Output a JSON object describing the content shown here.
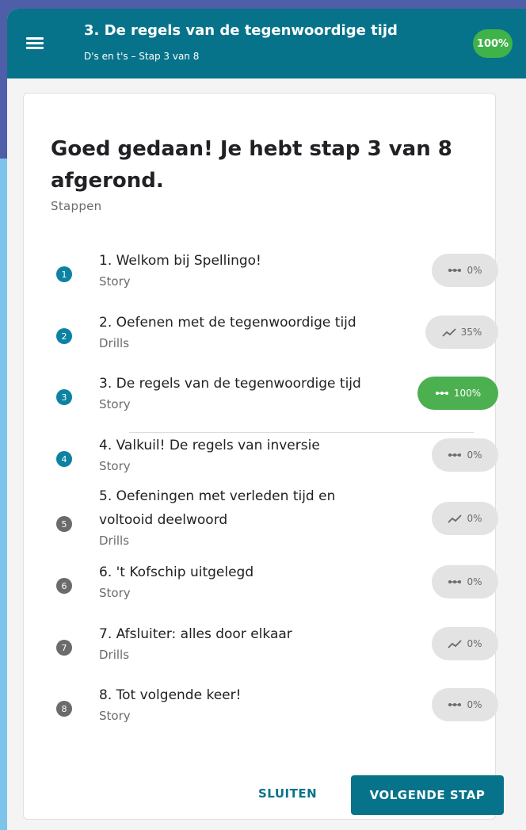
{
  "header": {
    "title": "3. De regels van de tegenwoordige tijd",
    "subtitle": "D's en t's – Stap 3 van 8",
    "progress": "100%"
  },
  "card": {
    "heading": "Goed gedaan! Je hebt stap 3 van 8 afgerond.",
    "steps_label": "Stappen"
  },
  "steps": [
    {
      "num": "1",
      "title": "1. Welkom bij Spellingo!",
      "kind": "Story",
      "progress": "0%",
      "icon": "dots-icon",
      "status": "done"
    },
    {
      "num": "2",
      "title": "2. Oefenen met de tegenwoordige tijd",
      "kind": "Drills",
      "progress": "35%",
      "icon": "trend-icon",
      "status": "done"
    },
    {
      "num": "3",
      "title": "3. De regels van de tegenwoordige tijd",
      "kind": "Story",
      "progress": "100%",
      "icon": "dots-icon",
      "status": "done"
    },
    {
      "num": "4",
      "title": "4. Valkuil! De regels van inversie",
      "kind": "Story",
      "progress": "0%",
      "icon": "dots-icon",
      "status": "next"
    },
    {
      "num": "5",
      "title": "5. Oefeningen met verleden tijd en voltooid deelwoord",
      "kind": "Drills",
      "progress": "0%",
      "icon": "trend-icon",
      "status": "locked"
    },
    {
      "num": "6",
      "title": "6. 't Kofschip uitgelegd",
      "kind": "Story",
      "progress": "0%",
      "icon": "dots-icon",
      "status": "locked"
    },
    {
      "num": "7",
      "title": "7. Afsluiter: alles door elkaar",
      "kind": "Drills",
      "progress": "0%",
      "icon": "trend-icon",
      "status": "locked"
    },
    {
      "num": "8",
      "title": "8. Tot volgende keer!",
      "kind": "Story",
      "progress": "0%",
      "icon": "dots-icon",
      "status": "locked"
    }
  ],
  "actions": {
    "close": "SLUITEN",
    "next": "VOLGENDE STAP"
  },
  "colors": {
    "primary": "#07738a",
    "success": "#4cb050",
    "step_active": "#0d82a3",
    "step_locked": "#6b6b6b",
    "badge_neutral": "#e3e3e3"
  }
}
